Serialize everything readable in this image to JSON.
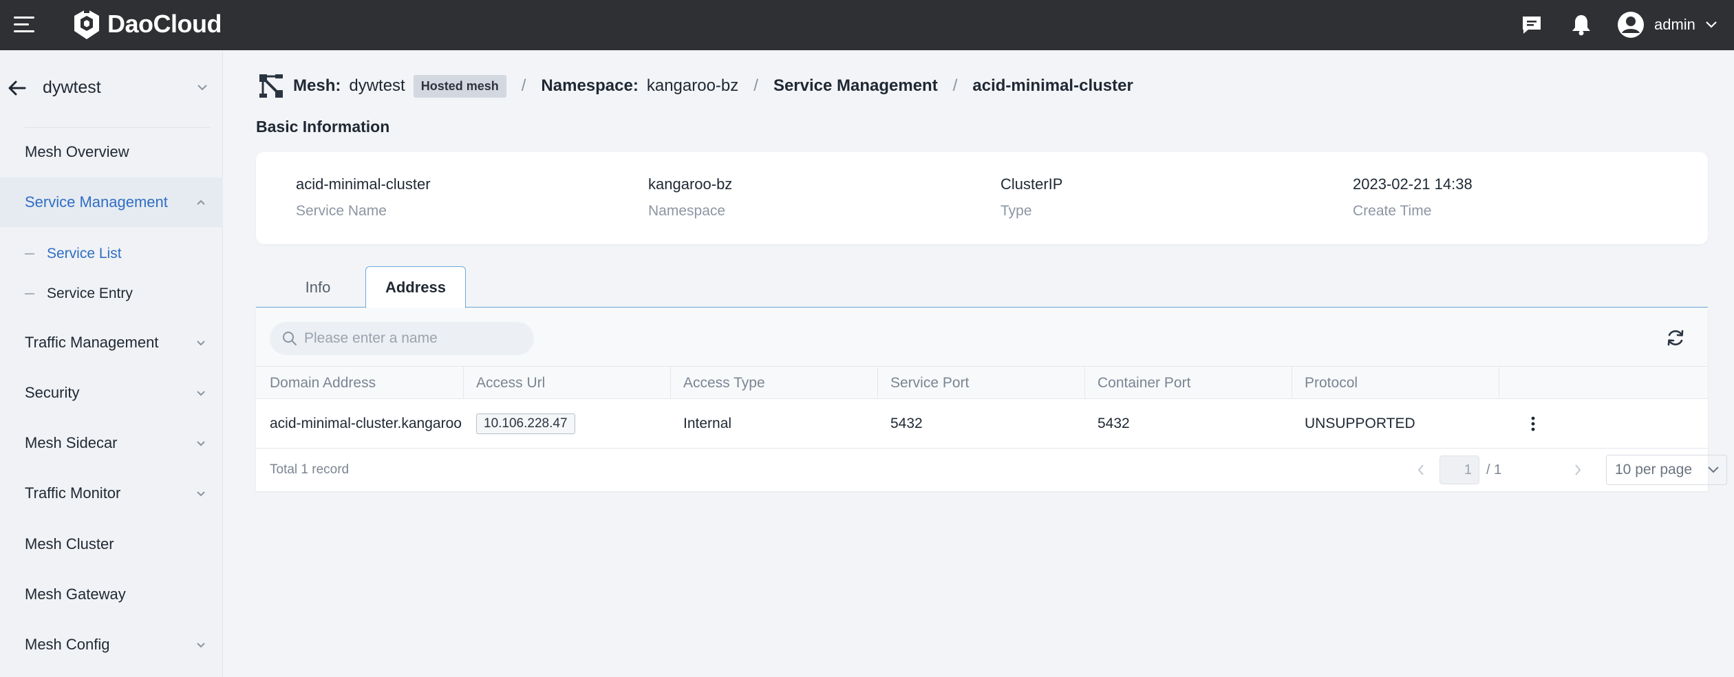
{
  "topbar": {
    "brand": "DaoCloud",
    "user_name": "admin",
    "icons": [
      "menu-icon",
      "logo-icon",
      "message-icon",
      "bell-icon",
      "user-avatar-icon",
      "chevron-down-icon"
    ]
  },
  "sidebar": {
    "mesh_name": "dywtest",
    "items": [
      {
        "label": "Mesh Overview"
      },
      {
        "label": "Service Management"
      },
      {
        "label": "Service List"
      },
      {
        "label": "Service Entry"
      },
      {
        "label": "Traffic Management"
      },
      {
        "label": "Security"
      },
      {
        "label": "Mesh Sidecar"
      },
      {
        "label": "Traffic Monitor"
      },
      {
        "label": "Mesh Cluster"
      },
      {
        "label": "Mesh Gateway"
      },
      {
        "label": "Mesh Config"
      }
    ]
  },
  "breadcrumb": {
    "mesh_label": "Mesh:",
    "mesh_value": "dywtest",
    "mesh_badge": "Hosted mesh",
    "namespace_label": "Namespace:",
    "namespace_value": "kangaroo-bz",
    "section": "Service Management",
    "current": "acid-minimal-cluster",
    "separator": "/"
  },
  "basic_info": {
    "title": "Basic Information",
    "items": [
      {
        "value": "acid-minimal-cluster",
        "label": "Service Name"
      },
      {
        "value": "kangaroo-bz",
        "label": "Namespace"
      },
      {
        "value": "ClusterIP",
        "label": "Type"
      },
      {
        "value": "2023-02-21 14:38",
        "label": "Create Time"
      }
    ]
  },
  "tabs": [
    {
      "label": "Info",
      "active": false
    },
    {
      "label": "Address",
      "active": true
    }
  ],
  "table": {
    "search_placeholder": "Please enter a name",
    "columns": [
      "Domain Address",
      "Access Url",
      "Access Type",
      "Service Port",
      "Container Port",
      "Protocol"
    ],
    "rows": [
      {
        "domain_address": "acid-minimal-cluster.kangaroo",
        "access_url": "10.106.228.47",
        "access_type": "Internal",
        "service_port": "5432",
        "container_port": "5432",
        "protocol": "UNSUPPORTED"
      }
    ],
    "total_text": "Total 1 record",
    "pagination": {
      "current": "1",
      "total_text": "/ 1",
      "page_size": "10 per page"
    }
  },
  "colors": {
    "accent": "#2f6ec4",
    "topbar": "#2f3033",
    "tab_border": "#6fa8dc"
  }
}
